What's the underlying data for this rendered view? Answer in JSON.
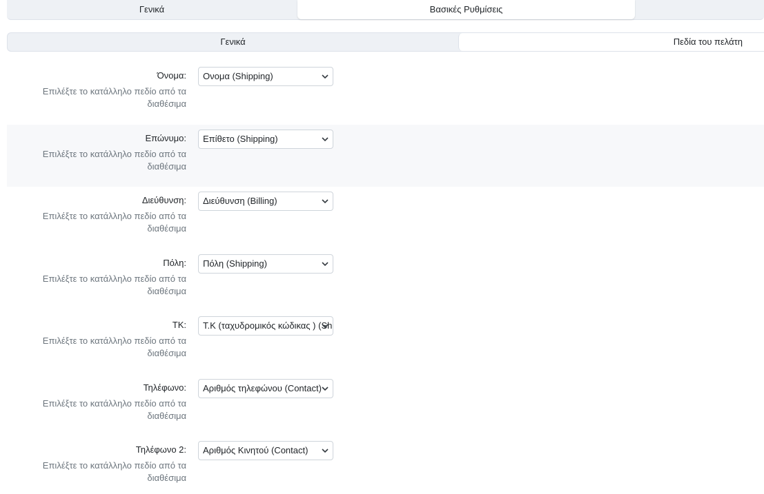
{
  "tabs_top": [
    {
      "label": "Γενικά"
    },
    {
      "label": "Βασικές Ρυθμίσεις"
    }
  ],
  "tabs_sub": [
    {
      "label": "Γενικά"
    },
    {
      "label": "Πεδία του πελάτη"
    }
  ],
  "fields": [
    {
      "label": "Όνομα:",
      "help": "Επιλέξτε το κατάλληλο πεδίο από τα διαθέσιμα",
      "value": "Ονομα (Shipping)"
    },
    {
      "label": "Επώνυμο:",
      "help": "Επιλέξτε το κατάλληλο πεδίο από τα διαθέσιμα",
      "value": "Επίθετο (Shipping)"
    },
    {
      "label": "Διεύθυνση:",
      "help": "Επιλέξτε το κατάλληλο πεδίο από τα διαθέσιμα",
      "value": "Διεύθυνση (Billing)"
    },
    {
      "label": "Πόλη:",
      "help": "Επιλέξτε το κατάλληλο πεδίο από τα διαθέσιμα",
      "value": "Πόλη (Shipping)"
    },
    {
      "label": "ΤΚ:",
      "help": "Επιλέξτε το κατάλληλο πεδίο από τα διαθέσιμα",
      "value": "Τ.Κ (ταχυδρομικός κώδικας ) (Shipping)"
    },
    {
      "label": "Τηλέφωνο:",
      "help": "Επιλέξτε το κατάλληλο πεδίο από τα διαθέσιμα",
      "value": "Αριθμός τηλεφώνου (Contact)"
    },
    {
      "label": "Τηλέφωνο 2:",
      "help": "Επιλέξτε το κατάλληλο πεδίο από τα διαθέσιμα",
      "value": "Αριθμός Κινητού (Contact)"
    }
  ]
}
